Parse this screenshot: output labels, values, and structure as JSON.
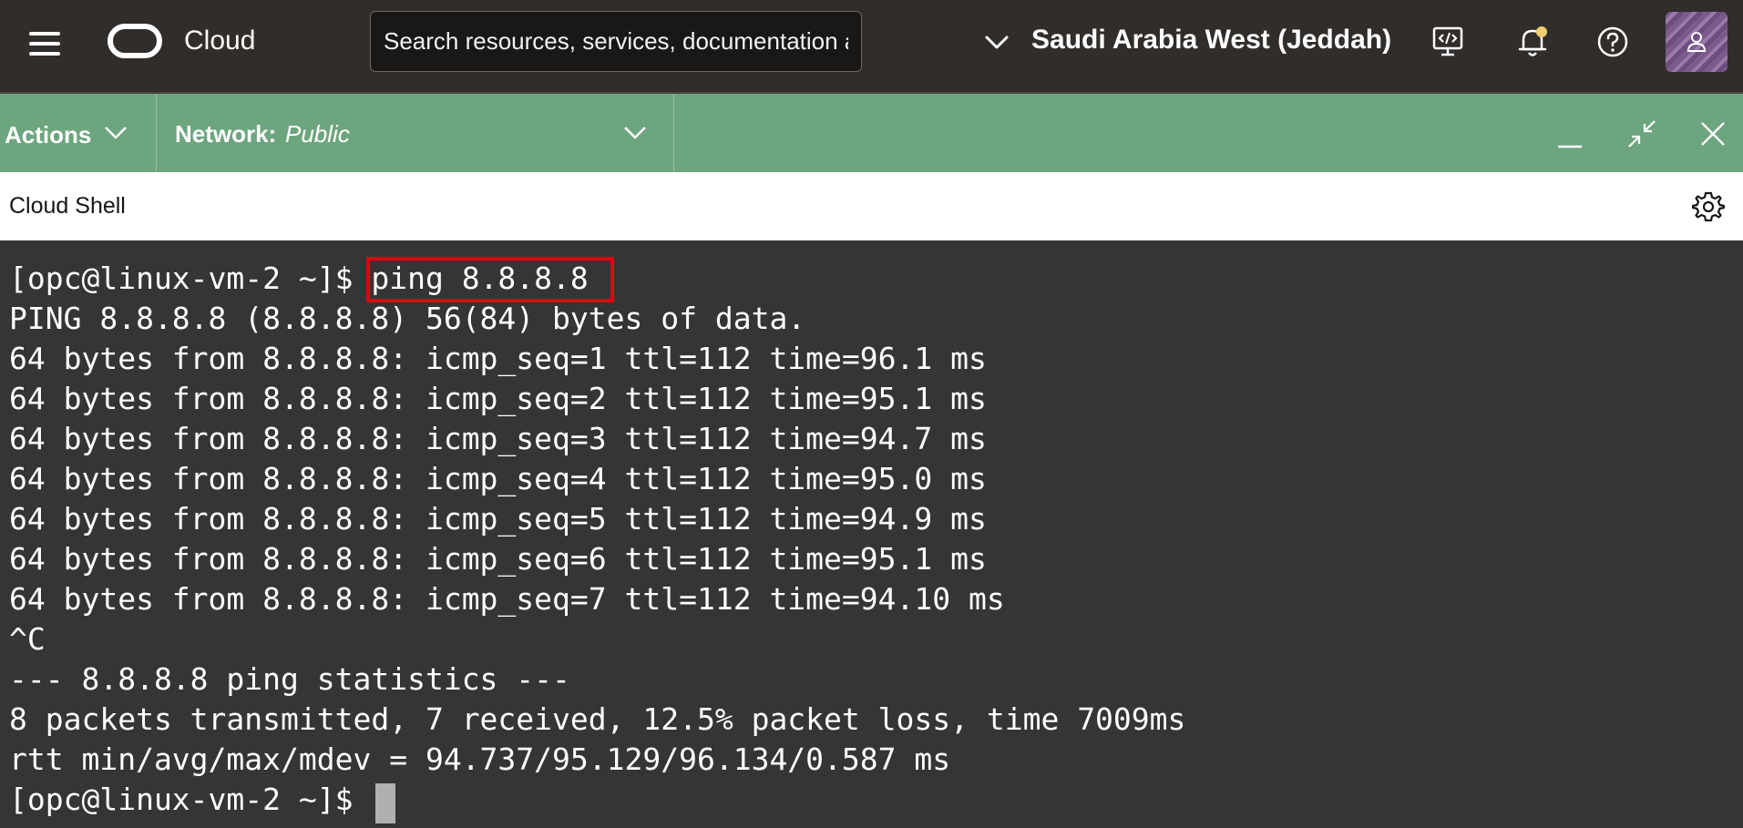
{
  "topbar": {
    "menu_icon": "hamburger-menu-icon",
    "logo_icon": "oracle-logo-icon",
    "brand": "Cloud",
    "search_placeholder": "Search resources, services, documentation and Marketplace",
    "region": "Saudi Arabia West (Jeddah)",
    "icons": [
      "chevron-down-icon",
      "developer-tools-icon",
      "notifications-bell-icon",
      "help-icon",
      "user-avatar"
    ],
    "notification_dot_color": "#f0cc71"
  },
  "actionbar": {
    "actions_label": "Actions",
    "network_key": "Network:",
    "network_value": "Public",
    "background_color": "#6da57e",
    "window_buttons": [
      "minimize-icon",
      "restore-icon",
      "close-icon"
    ]
  },
  "shell": {
    "title": "Cloud Shell",
    "settings_icon": "gear-icon"
  },
  "terminal": {
    "prompt": "[opc@linux-vm-2 ~]$ ",
    "command": "ping 8.8.8.8",
    "highlight_color": "#e3000f",
    "lines": [
      "PING 8.8.8.8 (8.8.8.8) 56(84) bytes of data.",
      "64 bytes from 8.8.8.8: icmp_seq=1 ttl=112 time=96.1 ms",
      "64 bytes from 8.8.8.8: icmp_seq=2 ttl=112 time=95.1 ms",
      "64 bytes from 8.8.8.8: icmp_seq=3 ttl=112 time=94.7 ms",
      "64 bytes from 8.8.8.8: icmp_seq=4 ttl=112 time=95.0 ms",
      "64 bytes from 8.8.8.8: icmp_seq=5 ttl=112 time=94.9 ms",
      "64 bytes from 8.8.8.8: icmp_seq=6 ttl=112 time=95.1 ms",
      "64 bytes from 8.8.8.8: icmp_seq=7 ttl=112 time=94.10 ms",
      "^C",
      "--- 8.8.8.8 ping statistics ---",
      "8 packets transmitted, 7 received, 12.5% packet loss, time 7009ms",
      "rtt min/avg/max/mdev = 94.737/95.129/96.134/0.587 ms"
    ],
    "final_prompt": "[opc@linux-vm-2 ~]$"
  }
}
